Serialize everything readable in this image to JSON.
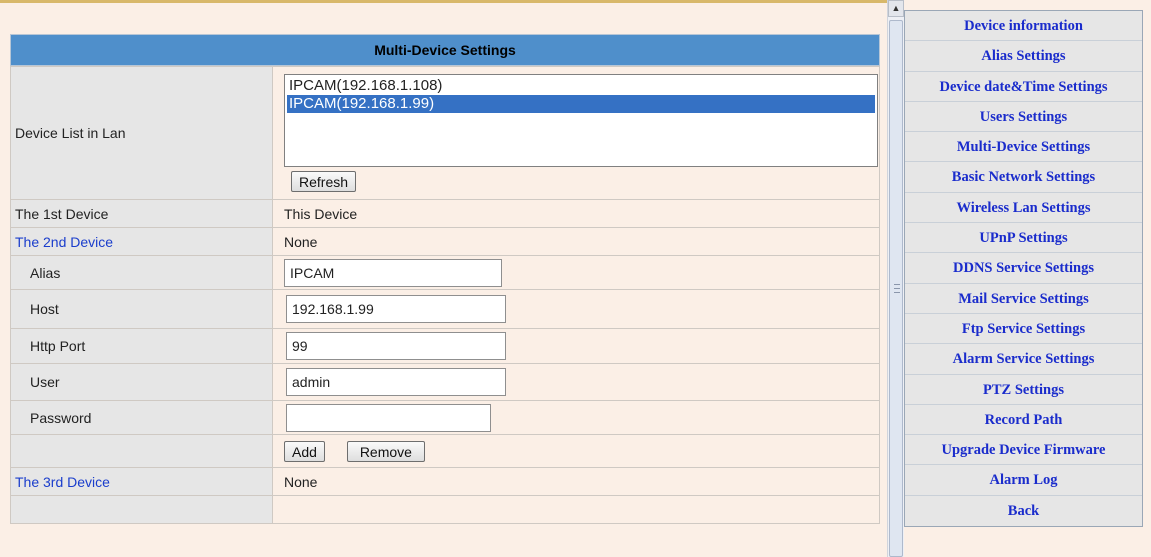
{
  "section_title": "Multi-Device Settings",
  "device_list": {
    "label": "Device List in Lan",
    "options": [
      "IPCAM(192.168.1.108)",
      "IPCAM(192.168.1.99)"
    ],
    "selected_index": 1,
    "refresh_label": "Refresh"
  },
  "devices": {
    "first": {
      "label": "The 1st Device",
      "value": "This Device"
    },
    "second": {
      "label": "The 2nd Device",
      "value": "None"
    },
    "third": {
      "label": "The 3rd Device",
      "value": "None"
    }
  },
  "form": {
    "alias_label": "Alias",
    "alias_value": "IPCAM",
    "host_label": "Host",
    "host_value": "192.168.1.99",
    "port_label": "Http Port",
    "port_value": "99",
    "user_label": "User",
    "user_value": "admin",
    "password_label": "Password",
    "password_value": "",
    "add_label": "Add",
    "remove_label": "Remove"
  },
  "scrollbar": {
    "up_icon": "chevron-up-icon"
  },
  "menu": {
    "items": [
      "Device information",
      "Alias Settings",
      "Device date&Time Settings",
      "Users Settings",
      "Multi-Device Settings",
      "Basic Network Settings",
      "Wireless Lan Settings",
      "UPnP Settings",
      "DDNS Service Settings",
      "Mail Service Settings",
      "Ftp Service Settings",
      "Alarm Service Settings",
      "PTZ Settings",
      "Record Path",
      "Upgrade Device Firmware",
      "Alarm Log",
      "Back"
    ]
  },
  "colors": {
    "header": "#4f8fcb",
    "link": "#1a2ccc",
    "selection": "#3571c4"
  }
}
